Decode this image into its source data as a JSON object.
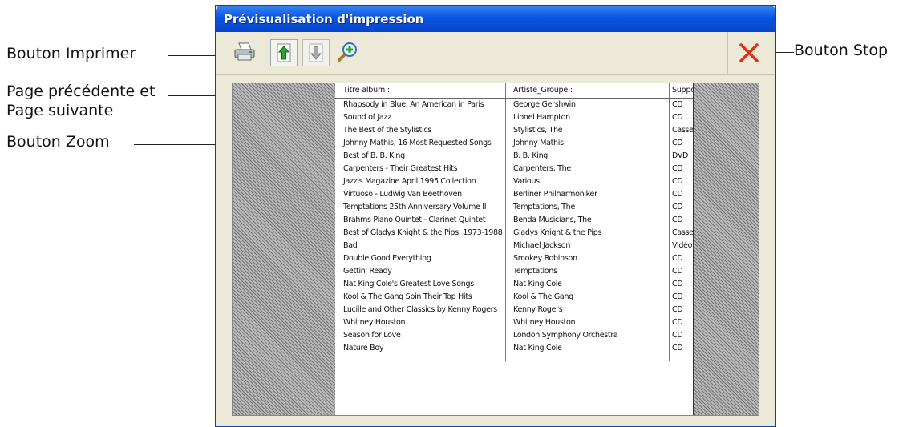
{
  "window": {
    "title": "Prévisualisation d'impression"
  },
  "toolbar": {
    "print_icon": "printer-icon",
    "prev_icon": "arrow-up-icon",
    "next_icon": "arrow-down-icon",
    "zoom_icon": "magnifier-zoom-icon",
    "stop_icon": "close-x-icon",
    "accent": "#e03010"
  },
  "callouts": {
    "print": "Bouton Imprimer",
    "prev_line1": "Page précédente et",
    "prev_line2": "Page suivante",
    "zoom": "Bouton Zoom",
    "stop": "Bouton Stop"
  },
  "table": {
    "headers": [
      "Titre album :",
      "Artiste_Groupe :",
      "Suppo"
    ],
    "rows": [
      [
        "Rhapsody in Blue, An American in Paris",
        "George Gershwin",
        "CD"
      ],
      [
        "Sound of Jazz",
        "Lionel Hampton",
        "CD"
      ],
      [
        "The Best of the Stylistics",
        "Stylistics, The",
        "Casse"
      ],
      [
        "Johnny Mathis, 16 Most Requested Songs",
        "Johnny Mathis",
        "CD"
      ],
      [
        "Best of B. B. King",
        "B. B. King",
        "DVD"
      ],
      [
        "Carpenters - Their Greatest Hits",
        "Carpenters, The",
        "CD"
      ],
      [
        "Jazzis Magazine April 1995 Collection",
        "Various",
        "CD"
      ],
      [
        "Virtuoso - Ludwig Van Beethoven",
        "Berliner Philharmoniker",
        "CD"
      ],
      [
        "Temptations 25th Anniversary Volume II",
        "Temptations, The",
        "CD"
      ],
      [
        "Brahms Piano Quintet - Clarinet Quintet",
        "Benda Musicians, The",
        "CD"
      ],
      [
        "Best of Gladys Knight & the Pips, 1973-1988",
        "Gladys Knight & the Pips",
        "Casse"
      ],
      [
        "Bad",
        "Michael Jackson",
        "Vidéo"
      ],
      [
        "Double Good Everything",
        "Smokey Robinson",
        "CD"
      ],
      [
        "Gettin' Ready",
        "Temptations",
        "CD"
      ],
      [
        "Nat King Cole's Greatest Love Songs",
        "Nat King Cole",
        "CD"
      ],
      [
        "Kool & The Gang Spin Their Top Hits",
        "Kool & The Gang",
        "CD"
      ],
      [
        "Lucille and Other Classics by Kenny Rogers",
        "Kenny Rogers",
        "CD"
      ],
      [
        "Whitney Houston",
        "Whitney Houston",
        "CD"
      ],
      [
        "Season for Love",
        "London Symphony Orchestra",
        "CD"
      ],
      [
        "Nature Boy",
        "Nat King Cole",
        "CD"
      ]
    ]
  }
}
